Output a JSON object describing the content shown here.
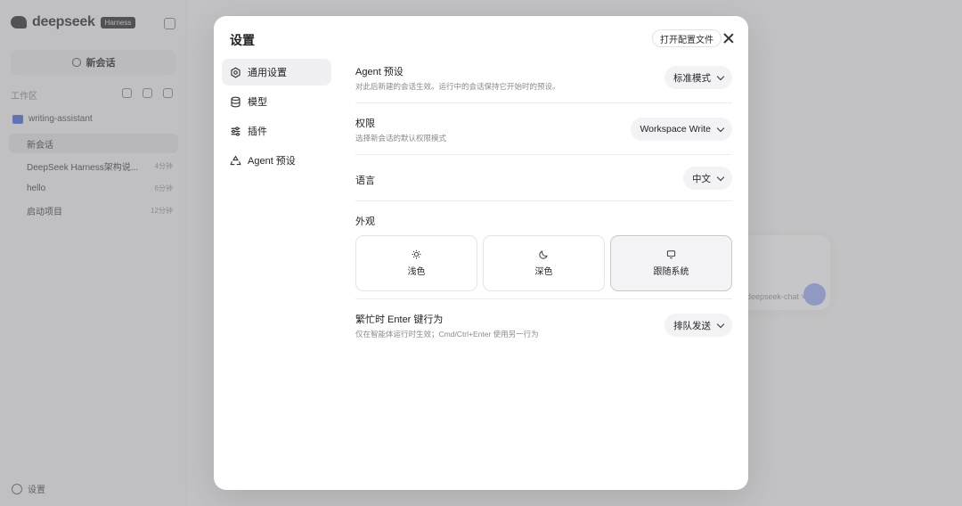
{
  "app": {
    "brand": "deepseek",
    "brand_badge": "Harness",
    "new_chat_label": "新会话",
    "section_label": "工作区",
    "folder_name": "writing-assistant",
    "conversations": [
      {
        "title": "新会话",
        "time": ""
      },
      {
        "title": "DeepSeek Harness架构说...",
        "time": "4分钟"
      },
      {
        "title": "hello",
        "time": "6分钟"
      },
      {
        "title": "启动项目",
        "time": "12分钟"
      }
    ],
    "settings_label": "设置",
    "model_hint": "deepseek-chat ˅"
  },
  "modal": {
    "title": "设置",
    "open_config_label": "打开配置文件",
    "nav": [
      {
        "label": "通用设置",
        "icon": "gear-icon",
        "active": true
      },
      {
        "label": "模型",
        "icon": "database-icon",
        "active": false
      },
      {
        "label": "插件",
        "icon": "sliders-icon",
        "active": false
      },
      {
        "label": "Agent 预设",
        "icon": "recycle-icon",
        "active": false
      }
    ],
    "settings": {
      "agent_preset": {
        "title": "Agent 预设",
        "desc": "对此后新建的会话生效。运行中的会话保持它开始时的预设。",
        "value": "标准模式"
      },
      "permission": {
        "title": "权限",
        "desc": "选择新会话的默认权限模式",
        "value": "Workspace Write"
      },
      "language": {
        "title": "语言",
        "value": "中文"
      },
      "appearance": {
        "title": "外观",
        "options": [
          {
            "label": "浅色",
            "icon": "sun-icon"
          },
          {
            "label": "深色",
            "icon": "moon-icon"
          },
          {
            "label": "跟随系统",
            "icon": "monitor-icon"
          }
        ],
        "selected": "跟随系统"
      },
      "busy_enter": {
        "title": "繁忙时 Enter 键行为",
        "desc": "仅在智能体运行时生效；Cmd/Ctrl+Enter 使用另一行为",
        "value": "排队发送"
      }
    }
  }
}
